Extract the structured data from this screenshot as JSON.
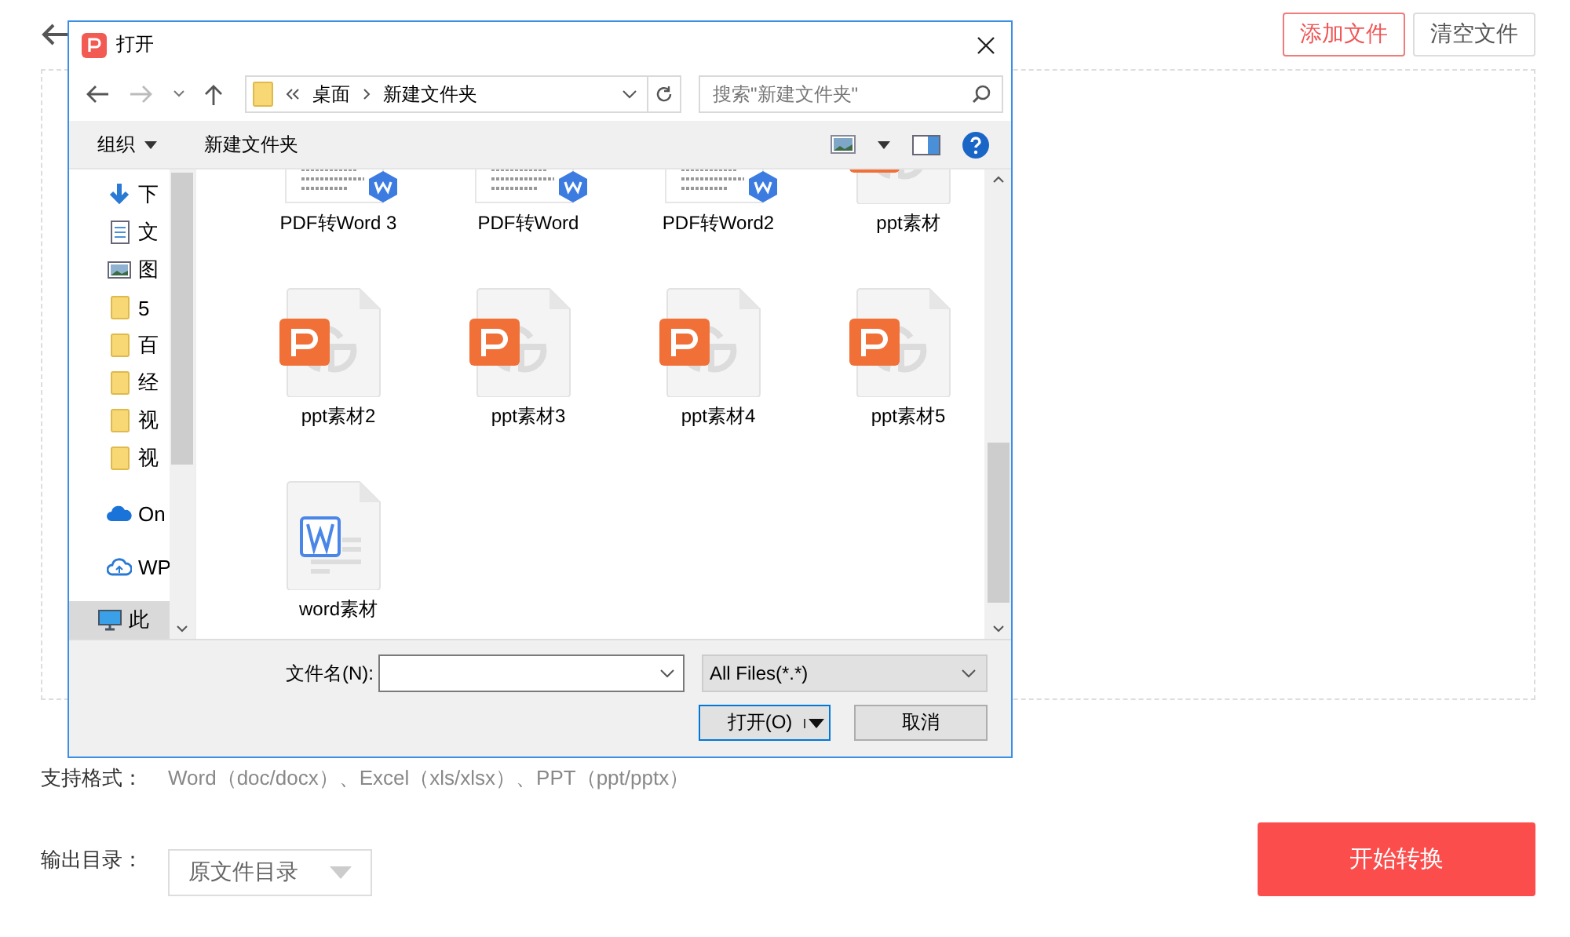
{
  "page": {
    "top_buttons": [
      {
        "label": "添加文件",
        "kind": "primary"
      },
      {
        "label": "清空文件",
        "kind": "plain"
      }
    ],
    "formats_label": "支持格式：",
    "formats": "Word（doc/docx）、Excel（xls/xlsx）、PPT（ppt/pptx）",
    "output_label": "输出目录：",
    "output_select": "原文件目录",
    "start_button": "开始转换"
  },
  "dialog": {
    "title": "打开",
    "breadcrumb": [
      "桌面",
      "新建文件夹"
    ],
    "search": {
      "placeholder": "搜索\"新建文件夹\""
    },
    "toolbar": {
      "organize": "组织",
      "new_folder": "新建文件夹"
    },
    "sidebar": [
      {
        "label": "下",
        "kind": "download",
        "selected": false
      },
      {
        "label": "文",
        "kind": "document",
        "selected": false
      },
      {
        "label": "图",
        "kind": "image",
        "selected": false
      },
      {
        "label": "5",
        "kind": "folder",
        "selected": false
      },
      {
        "label": "百",
        "kind": "folder",
        "selected": false
      },
      {
        "label": "经",
        "kind": "folder",
        "selected": false
      },
      {
        "label": "视",
        "kind": "folder",
        "selected": false
      },
      {
        "label": "视",
        "kind": "folder",
        "selected": false
      },
      {
        "label": "On",
        "kind": "cloud",
        "selected": false
      },
      {
        "label": "WP",
        "kind": "cloud-outline",
        "selected": false
      },
      {
        "label": "此",
        "kind": "computer",
        "selected": true
      }
    ],
    "files": [
      {
        "name": "PDF转Word 3",
        "kind": "pdf-doc"
      },
      {
        "name": "PDF转Word",
        "kind": "pdf-doc"
      },
      {
        "name": "PDF转Word2",
        "kind": "pdf-doc"
      },
      {
        "name": "ppt素材",
        "kind": "ppt"
      },
      {
        "name": "ppt素材2",
        "kind": "ppt"
      },
      {
        "name": "ppt素材3",
        "kind": "ppt"
      },
      {
        "name": "ppt素材4",
        "kind": "ppt"
      },
      {
        "name": "ppt素材5",
        "kind": "ppt"
      },
      {
        "name": "word素材",
        "kind": "word"
      }
    ],
    "filename_label": "文件名(N):",
    "filter": "All Files(*.*)",
    "open_button": "打开(O)",
    "cancel_button": "取消"
  }
}
